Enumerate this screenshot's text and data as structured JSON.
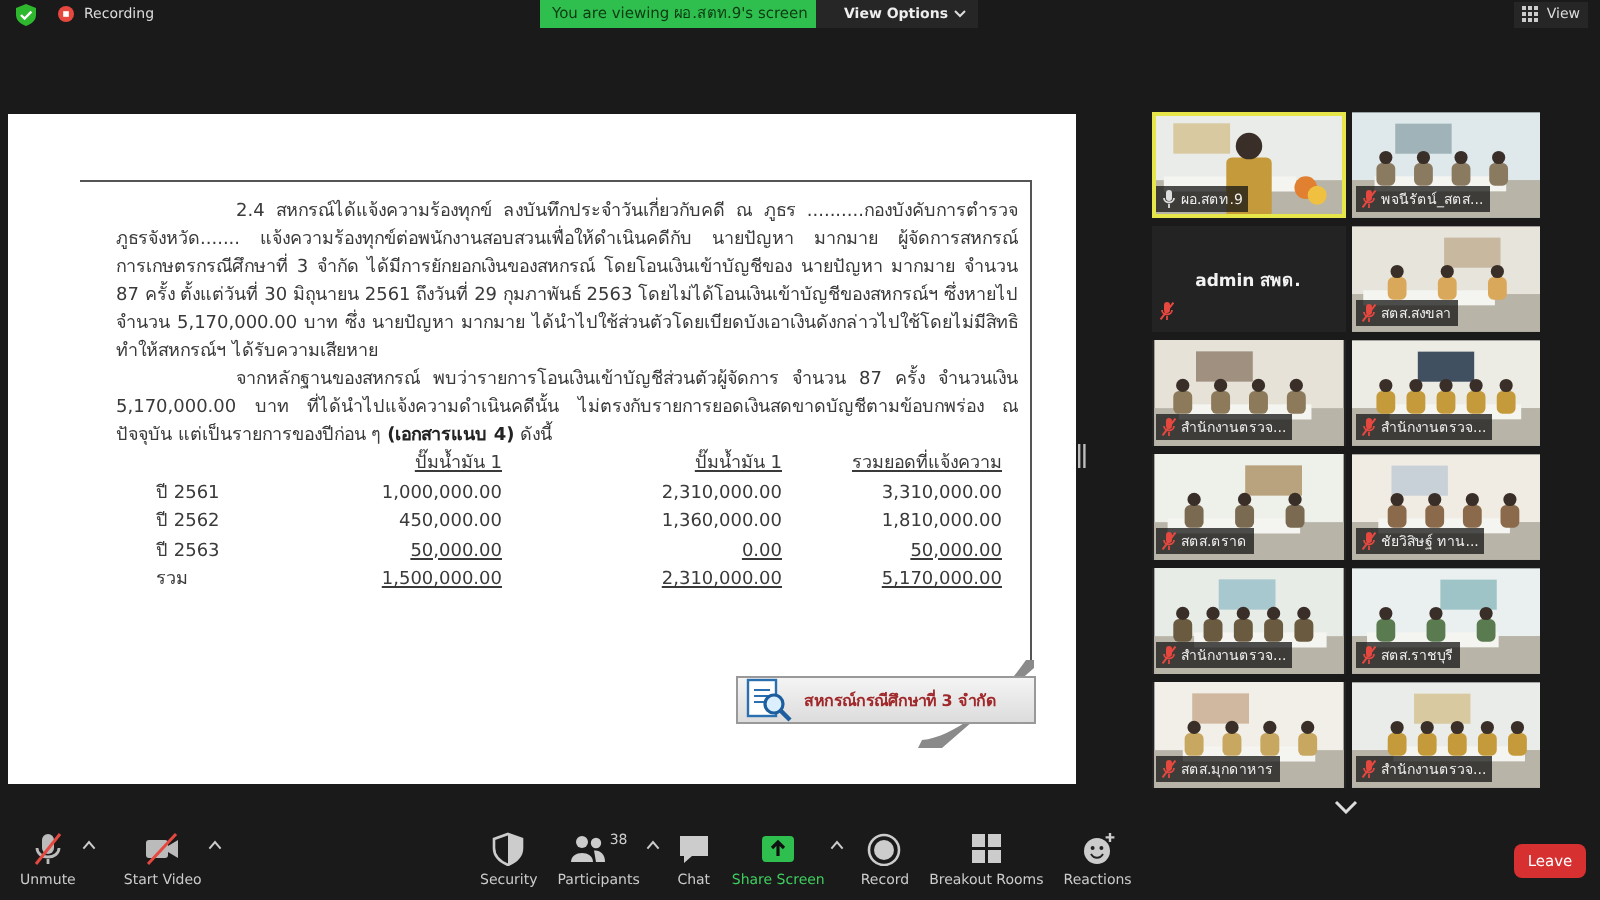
{
  "top_bar": {
    "recording_label": "Recording",
    "banner": "You are viewing ผอ.สตท.9's screen",
    "view_options": "View Options",
    "view_button": "View"
  },
  "slide": {
    "paragraphs": [
      "2.4  สหกรณ์ได้แจ้งความร้องทุกข์ ลงบันทึกประจำวันเกี่ยวกับคดี ณ ภูธร ..........กองบังคับการตำรวจภูธรจังหวัด....... แจ้งความร้องทุกข์ต่อพนักงานสอบสวนเพื่อให้ดำเนินคดีกับ นายปัญหา  มากมาย ผู้จัดการสหกรณ์การเกษตรกรณีศึกษาที่ 3 จำกัด ได้มีการยักยอกเงินของสหกรณ์ โดยโอนเงินเข้าบัญชีของ นายปัญหา  มากมาย  จำนวน 87 ครั้ง  ตั้งแต่วันที่ 30 มิถุนายน 2561 ถึงวันที่ 29 กุมภาพันธ์ 2563 โดยไม่ได้โอนเงินเข้าบัญชีของสหกรณ์ฯ ซึ่งหายไป จำนวน 5,170,000.00 บาท ซึ่ง นายปัญหา มากมาย ได้นำไปใช้ส่วนตัวโดยเบียดบังเอาเงินดังกล่าวไปใช้โดยไม่มีสิทธิ ทำให้สหกรณ์ฯ ได้รับความเสียหาย",
      "จากหลักฐานของสหกรณ์ พบว่ารายการโอนเงินเข้าบัญชีส่วนตัวผู้จัดการ จำนวน 87 ครั้ง จำนวนเงิน 5,170,000.00 บาท ที่ได้นำไปแจ้งความดำเนินคดีนั้น ไม่ตรงกับรายการยอดเงินสดขาดบัญชีตามข้อบกพร่อง ณ ปัจจุบัน  แต่เป็นรายการของปีก่อน ๆ **(เอกสารแนบ 4)** ดังนี้"
    ],
    "table": {
      "columns": [
        "ปั๊มน้ำมัน 1",
        "ปั๊มน้ำมัน 1",
        "รวมยอดที่แจ้งความ"
      ],
      "rows": [
        {
          "label": "ปี 2561",
          "cells": [
            "1,000,000.00",
            "2,310,000.00",
            "3,310,000.00"
          ],
          "underlined": false
        },
        {
          "label": "ปี 2562",
          "cells": [
            "450,000.00",
            "1,360,000.00",
            "1,810,000.00"
          ],
          "underlined": false
        },
        {
          "label": "ปี 2563",
          "cells": [
            "50,000.00",
            "0.00",
            "50,000.00"
          ],
          "underlined": true
        },
        {
          "label": "รวม",
          "cells": [
            "1,500,000.00",
            "2,310,000.00",
            "5,170,000.00"
          ],
          "underlined": true
        }
      ]
    },
    "caption": "สหกรณ์กรณีศึกษาที่ 3 จำกัด"
  },
  "gallery": [
    {
      "name": "ผอ.สตท.9",
      "kind": "video",
      "speaking": true,
      "muted": false
    },
    {
      "name": "พจนีรัตน์_สตส...",
      "kind": "video",
      "speaking": false,
      "muted": true
    },
    {
      "name": "admin สพด.",
      "kind": "no_video",
      "speaking": false,
      "muted": true
    },
    {
      "name": "สตส.สงขลา",
      "kind": "video",
      "speaking": false,
      "muted": true
    },
    {
      "name": "สำนักงานตรวจ...",
      "kind": "video",
      "speaking": false,
      "muted": true
    },
    {
      "name": "สำนักงานตรวจ...",
      "kind": "video",
      "speaking": false,
      "muted": true
    },
    {
      "name": "สตส.ตราด",
      "kind": "video",
      "speaking": false,
      "muted": true
    },
    {
      "name": "ชัยวิสิษฐ์ ทาน...",
      "kind": "video",
      "speaking": false,
      "muted": true
    },
    {
      "name": "สำนักงานตรวจ...",
      "kind": "video",
      "speaking": false,
      "muted": true
    },
    {
      "name": "สตส.ราชบุรี",
      "kind": "video",
      "speaking": false,
      "muted": true
    },
    {
      "name": "สตส.มุกดาหาร",
      "kind": "video",
      "speaking": false,
      "muted": true
    },
    {
      "name": "สำนักงานตรวจ...",
      "kind": "video",
      "speaking": false,
      "muted": true
    }
  ],
  "toolbar": [
    {
      "label": "Unmute",
      "kind": "mic_off",
      "menu": true
    },
    {
      "label": "Start Video",
      "kind": "video_off",
      "menu": true
    },
    {
      "label": "Security",
      "kind": "security",
      "menu": false
    },
    {
      "label": "Participants",
      "kind": "participants",
      "menu": true,
      "count": "38"
    },
    {
      "label": "Chat",
      "kind": "chat",
      "menu": false
    },
    {
      "label": "Share Screen",
      "kind": "share",
      "menu": true
    },
    {
      "label": "Record",
      "kind": "record",
      "menu": false
    },
    {
      "label": "Breakout Rooms",
      "kind": "breakout",
      "menu": false
    },
    {
      "label": "Reactions",
      "kind": "reactions",
      "menu": false
    }
  ],
  "leave_button": "Leave"
}
